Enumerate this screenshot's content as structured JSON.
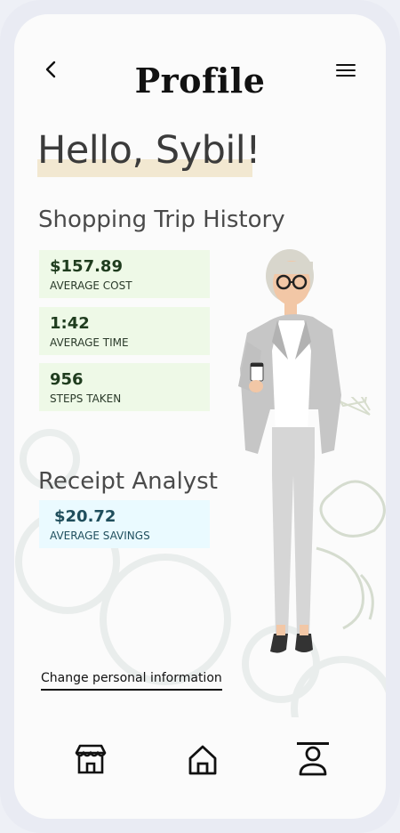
{
  "header": {
    "title": "Profile"
  },
  "greeting": {
    "text": "Hello, Sybil!"
  },
  "shopping": {
    "title": "Shopping Trip History",
    "stats": [
      {
        "value": "$157.89",
        "label": "AVERAGE COST"
      },
      {
        "value": "1:42",
        "label": "AVERAGE TIME"
      },
      {
        "value": "956",
        "label": "STEPS TAKEN"
      }
    ]
  },
  "receipt": {
    "title": "Receipt Analyst",
    "stats": [
      {
        "value": "$20.72",
        "label": "AVERAGE SAVINGS"
      }
    ]
  },
  "links": {
    "change_info": "Change personal information"
  },
  "nav": {
    "items": [
      {
        "icon": "store-icon"
      },
      {
        "icon": "home-icon"
      },
      {
        "icon": "user-icon"
      }
    ]
  },
  "colors": {
    "highlight": "#f1e7cf",
    "stat_green": "#eef9e7",
    "stat_blue": "#eafaff"
  }
}
